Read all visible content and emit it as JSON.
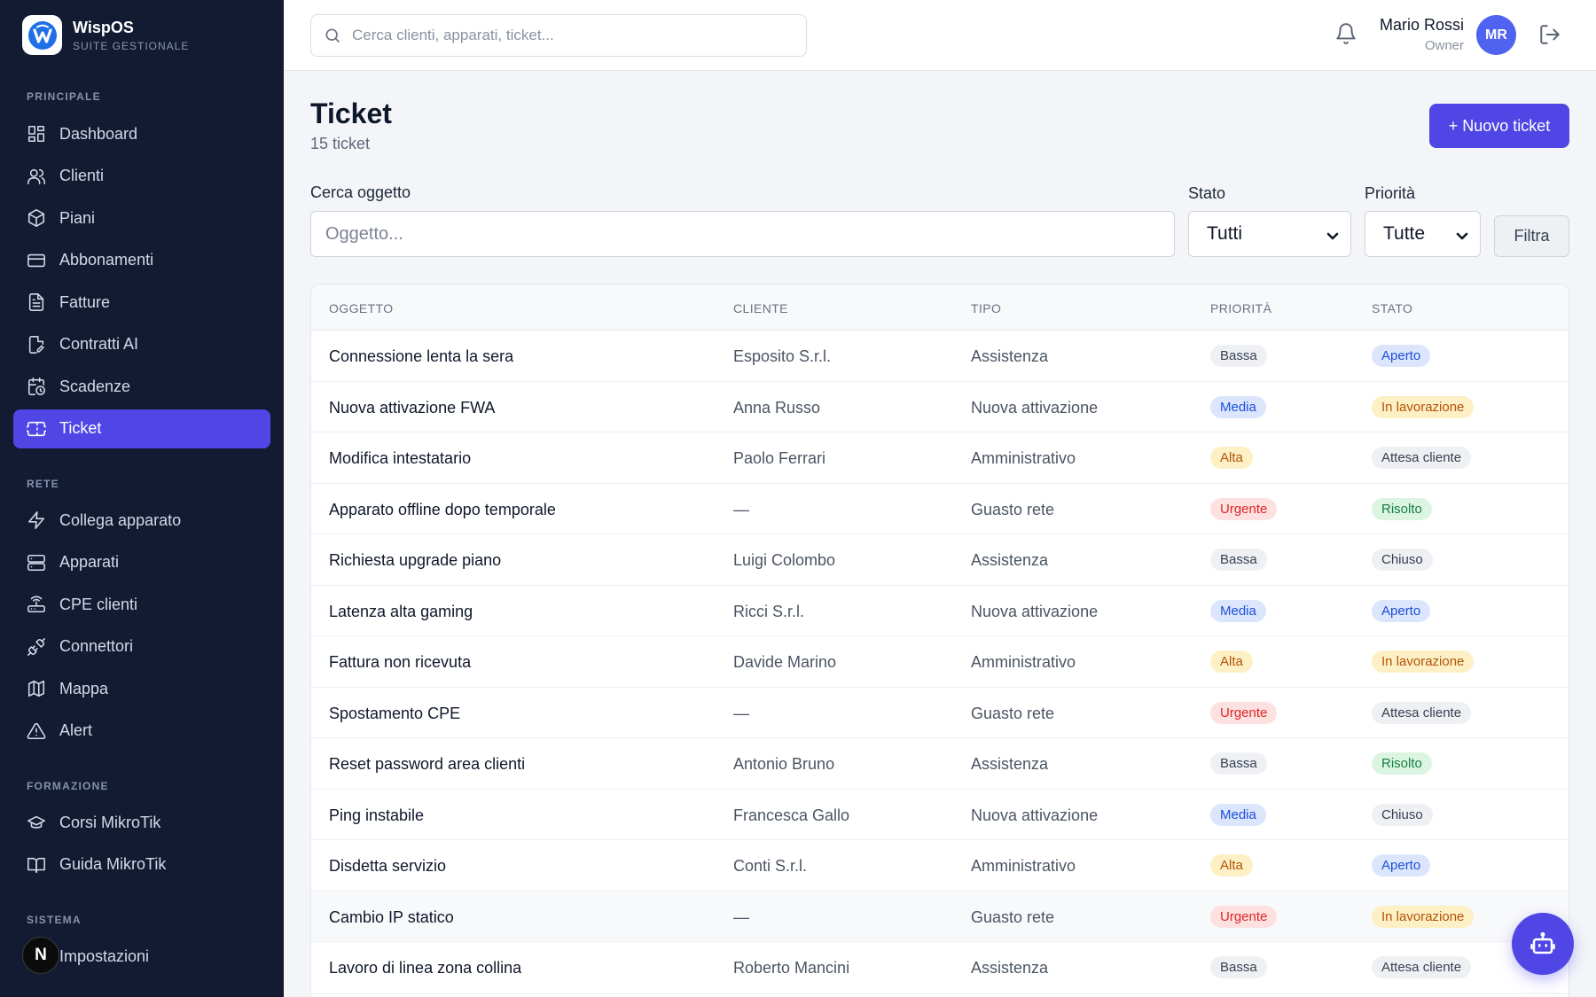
{
  "brand": {
    "name": "WispOS",
    "subtitle": "SUITE GESTIONALE",
    "logo_icon": "wispos-logo-icon"
  },
  "sidebar": {
    "sections": [
      {
        "title": "PRINCIPALE",
        "items": [
          {
            "label": "Dashboard",
            "icon": "dashboard-icon"
          },
          {
            "label": "Clienti",
            "icon": "users-icon"
          },
          {
            "label": "Piani",
            "icon": "package-icon"
          },
          {
            "label": "Abbonamenti",
            "icon": "credit-card-icon"
          },
          {
            "label": "Fatture",
            "icon": "invoice-icon"
          },
          {
            "label": "Contratti AI",
            "icon": "contract-icon"
          },
          {
            "label": "Scadenze",
            "icon": "calendar-clock-icon"
          },
          {
            "label": "Ticket",
            "icon": "ticket-icon",
            "active": true
          }
        ]
      },
      {
        "title": "RETE",
        "items": [
          {
            "label": "Collega apparato",
            "icon": "lightning-icon"
          },
          {
            "label": "Apparati",
            "icon": "server-icon"
          },
          {
            "label": "CPE clienti",
            "icon": "router-icon"
          },
          {
            "label": "Connettori",
            "icon": "plug-icon"
          },
          {
            "label": "Mappa",
            "icon": "map-icon"
          },
          {
            "label": "Alert",
            "icon": "alert-triangle-icon"
          }
        ]
      },
      {
        "title": "FORMAZIONE",
        "items": [
          {
            "label": "Corsi MikroTik",
            "icon": "graduation-cap-icon"
          },
          {
            "label": "Guida MikroTik",
            "icon": "book-icon"
          }
        ]
      },
      {
        "title": "SISTEMA",
        "items": [
          {
            "label": "Impostazioni",
            "icon": "settings-icon"
          }
        ]
      }
    ],
    "n_badge": "N"
  },
  "topbar": {
    "search_placeholder": "Cerca clienti, apparati, ticket...",
    "user_name": "Mario Rossi",
    "user_role": "Owner",
    "avatar_initials": "MR"
  },
  "page": {
    "title": "Ticket",
    "subtitle": "15 ticket",
    "new_button": "+ Nuovo ticket"
  },
  "filters": {
    "search_label": "Cerca oggetto",
    "search_placeholder": "Oggetto...",
    "stato_label": "Stato",
    "stato_value": "Tutti",
    "priorita_label": "Priorità",
    "priorita_value": "Tutte",
    "filter_button": "Filtra"
  },
  "table": {
    "headers": [
      "OGGETTO",
      "CLIENTE",
      "TIPO",
      "PRIORITÀ",
      "STATO"
    ],
    "rows": [
      {
        "oggetto": "Connessione lenta la sera",
        "cliente": "Esposito S.r.l.",
        "tipo": "Assistenza",
        "priorita": "Bassa",
        "stato": "Aperto"
      },
      {
        "oggetto": "Nuova attivazione FWA",
        "cliente": "Anna Russo",
        "tipo": "Nuova attivazione",
        "priorita": "Media",
        "stato": "In lavorazione"
      },
      {
        "oggetto": "Modifica intestatario",
        "cliente": "Paolo Ferrari",
        "tipo": "Amministrativo",
        "priorita": "Alta",
        "stato": "Attesa cliente"
      },
      {
        "oggetto": "Apparato offline dopo temporale",
        "cliente": "—",
        "tipo": "Guasto rete",
        "priorita": "Urgente",
        "stato": "Risolto"
      },
      {
        "oggetto": "Richiesta upgrade piano",
        "cliente": "Luigi Colombo",
        "tipo": "Assistenza",
        "priorita": "Bassa",
        "stato": "Chiuso"
      },
      {
        "oggetto": "Latenza alta gaming",
        "cliente": "Ricci S.r.l.",
        "tipo": "Nuova attivazione",
        "priorita": "Media",
        "stato": "Aperto"
      },
      {
        "oggetto": "Fattura non ricevuta",
        "cliente": "Davide Marino",
        "tipo": "Amministrativo",
        "priorita": "Alta",
        "stato": "In lavorazione"
      },
      {
        "oggetto": "Spostamento CPE",
        "cliente": "—",
        "tipo": "Guasto rete",
        "priorita": "Urgente",
        "stato": "Attesa cliente"
      },
      {
        "oggetto": "Reset password area clienti",
        "cliente": "Antonio Bruno",
        "tipo": "Assistenza",
        "priorita": "Bassa",
        "stato": "Risolto"
      },
      {
        "oggetto": "Ping instabile",
        "cliente": "Francesca Gallo",
        "tipo": "Nuova attivazione",
        "priorita": "Media",
        "stato": "Chiuso"
      },
      {
        "oggetto": "Disdetta servizio",
        "cliente": "Conti S.r.l.",
        "tipo": "Amministrativo",
        "priorita": "Alta",
        "stato": "Aperto"
      },
      {
        "oggetto": "Cambio IP statico",
        "cliente": "—",
        "tipo": "Guasto rete",
        "priorita": "Urgente",
        "stato": "In lavorazione"
      },
      {
        "oggetto": "Lavoro di linea zona collina",
        "cliente": "Roberto Mancini",
        "tipo": "Assistenza",
        "priorita": "Bassa",
        "stato": "Attesa cliente"
      }
    ]
  },
  "colors": {
    "accent": "#4f46e5",
    "sidebar_bg": "#131b33",
    "active_item": "#5046e5"
  }
}
